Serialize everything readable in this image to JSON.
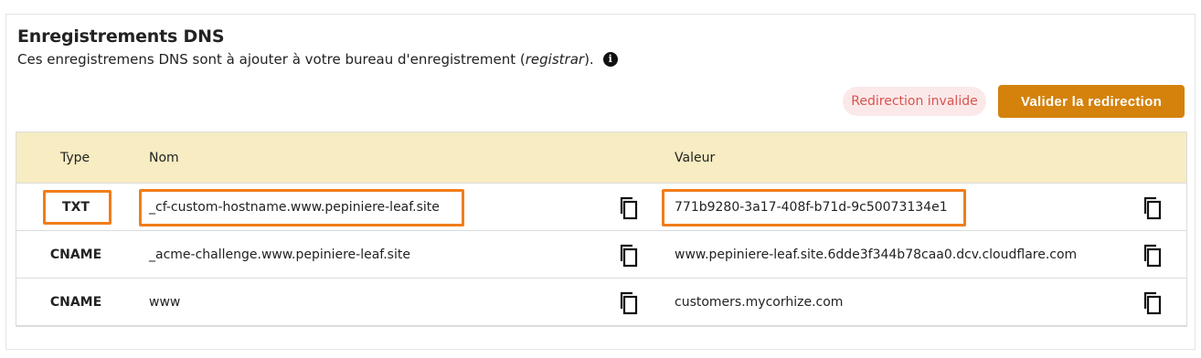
{
  "section": {
    "title": "Enregistrements DNS",
    "subtitle_before": "Ces enregistremens DNS sont à ajouter à votre bureau d'enregistrement (",
    "subtitle_italic": "registrar",
    "subtitle_after": ").",
    "info_icon": "info-icon"
  },
  "actions": {
    "status_badge": "Redirection invalide",
    "validate_button": "Valider la redirection"
  },
  "colors": {
    "accent": "#d4820c",
    "header_bg": "#f7ecc2",
    "badge_bg": "#fbe9e9",
    "badge_text": "#d9534f",
    "highlight": "#f07d1a"
  },
  "table": {
    "headers": {
      "type": "Type",
      "name": "Nom",
      "value": "Valeur"
    },
    "rows": [
      {
        "type": "TXT",
        "name": "_cf-custom-hostname.www.pepiniere-leaf.site",
        "value": "771b9280-3a17-408f-b71d-9c50073134e1",
        "highlighted": true
      },
      {
        "type": "CNAME",
        "name": "_acme-challenge.www.pepiniere-leaf.site",
        "value": "www.pepiniere-leaf.site.6dde3f344b78caa0.dcv.cloudflare.com",
        "highlighted": false
      },
      {
        "type": "CNAME",
        "name": "www",
        "value": "customers.mycorhize.com",
        "highlighted": false
      }
    ],
    "copy_icon": "copy-icon"
  }
}
